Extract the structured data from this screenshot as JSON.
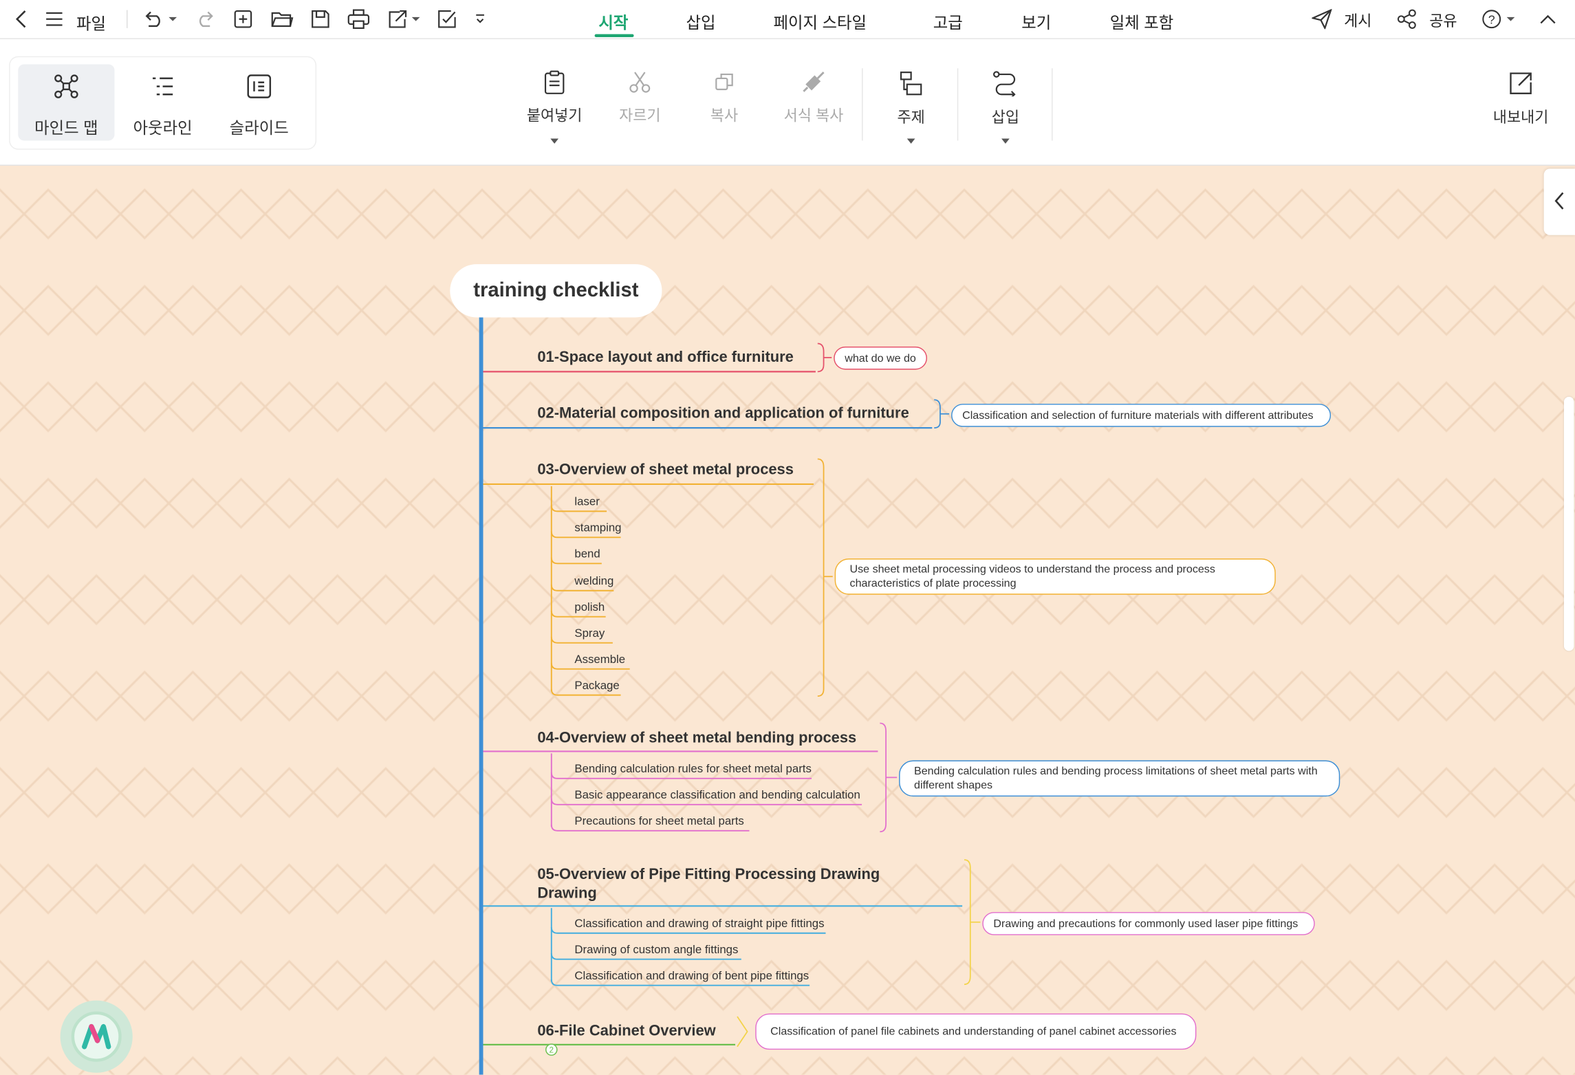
{
  "titlebar": {
    "file_label": "파일",
    "tabs": [
      {
        "label": "시작",
        "active": true
      },
      {
        "label": "삽입"
      },
      {
        "label": "페이지 스타일"
      },
      {
        "label": "고급"
      },
      {
        "label": "보기"
      },
      {
        "label": "일체 포함"
      }
    ],
    "publish_label": "게시",
    "share_label": "공유"
  },
  "ribbon": {
    "views": [
      {
        "label": "마인드 맵",
        "active": true
      },
      {
        "label": "아웃라인"
      },
      {
        "label": "슬라이드"
      }
    ],
    "paste_label": "붙여넣기",
    "cut_label": "자르기",
    "copy_label": "복사",
    "format_copy_label": "서식 복사",
    "topic_label": "주제",
    "insert_label": "삽입",
    "export_label": "내보내기"
  },
  "mindmap": {
    "root": "training checklist",
    "colors": {
      "t1": "#e5516b",
      "t2": "#3d8fd6",
      "t3": "#f2b233",
      "t4": "#e26fcd",
      "t5": "#43aedf",
      "t6": "#6bbf4e",
      "spine": "#3d8fd6"
    },
    "topics": [
      {
        "title": "01-Space layout and office furniture",
        "note": "what do we do",
        "subs": []
      },
      {
        "title": "02-Material composition and application of furniture",
        "note": "Classification and selection of furniture materials with different attributes",
        "subs": []
      },
      {
        "title": "03-Overview of sheet metal process",
        "note": "Use sheet metal processing videos to understand the process and process characteristics of plate processing",
        "subs": [
          "laser",
          "stamping",
          "bend",
          "welding",
          "polish",
          "Spray",
          "Assemble",
          "Package"
        ]
      },
      {
        "title": "04-Overview of sheet metal bending process",
        "note": "Bending calculation rules and bending process limitations of sheet metal parts with different shapes",
        "subs": [
          "Bending calculation rules for sheet metal parts",
          "Basic appearance classification and bending calculation",
          "Precautions for sheet metal parts"
        ]
      },
      {
        "title": "05-Overview of Pipe Fitting Processing Drawing Drawing",
        "note": "Drawing and precautions for commonly used laser pipe fittings",
        "subs": [
          "Classification and drawing of straight pipe fittings",
          "Drawing of custom angle fittings",
          "Classification and drawing of bent pipe fittings"
        ]
      },
      {
        "title": "06-File Cabinet Overview",
        "note": "Classification of panel file cabinets and understanding of panel cabinet accessories",
        "subs": [],
        "collapsed_count": "2"
      }
    ]
  }
}
